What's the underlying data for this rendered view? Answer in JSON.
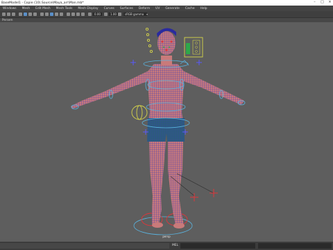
{
  "window": {
    "title": "BaseModel1 - Copie (10).Source\\Maya_arr\\Man.mb*"
  },
  "menu": [
    "Windows",
    "Mesh",
    "Edit Mesh",
    "Mesh Tools",
    "Mesh Display",
    "Curves",
    "Surfaces",
    "Deform",
    "UV",
    "Generate",
    "Cache",
    "Help"
  ],
  "toolbar": {
    "field_a": "0.00",
    "field_b": "1.00",
    "color_space": "sRGB gamma"
  },
  "panel": {
    "label": "Persem"
  },
  "viewport": {
    "camera_label": "persp"
  },
  "statusbar": {
    "mel_label": "MEL"
  },
  "colors": {
    "mesh_skin": "#c97a7a",
    "mesh_wire": "#3b39b8",
    "shorts": "#2c5c7c",
    "controls": "#5ab4e0",
    "yellow_ctrl": "#d7d54a",
    "red_ctrl": "#e0353a",
    "ik_cross": "#5858ff"
  }
}
